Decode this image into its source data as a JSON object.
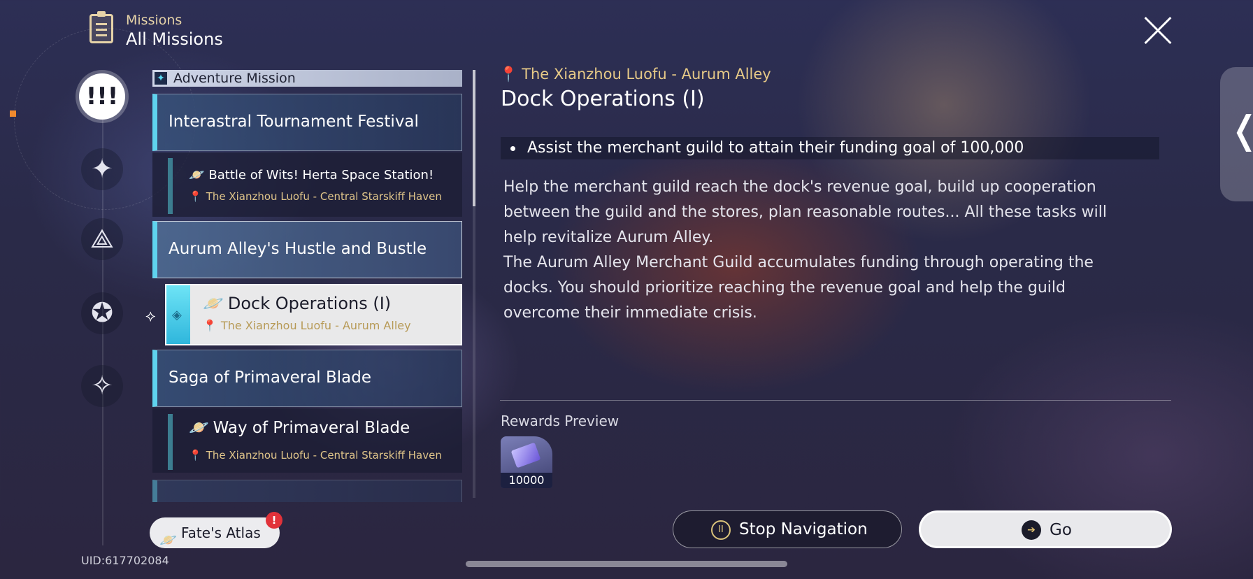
{
  "header": {
    "category": "Missions",
    "title": "All Missions",
    "icons": {
      "header": "clipboard-icon",
      "close": "close-icon"
    }
  },
  "rail": {
    "active_symbol": "!!!",
    "items": [
      {
        "name": "trailblaze-missions-icon",
        "symbol": "✦"
      },
      {
        "name": "companion-missions-icon",
        "symbol": "⟁"
      },
      {
        "name": "adventure-missions-icon",
        "symbol": "✪"
      },
      {
        "name": "daily-missions-icon",
        "symbol": "✧"
      }
    ],
    "marker_color": "#f08a2e"
  },
  "mission_list": {
    "category": "Adventure Mission",
    "category_icon": "✦",
    "groups": [
      {
        "title": "Interastral Tournament Festival",
        "missions": [
          {
            "title": "Battle of Wits! Herta Space Station!",
            "location": "The Xianzhou Luofu - Central Starskiff Haven"
          }
        ]
      },
      {
        "title": "Aurum Alley's Hustle and Bustle",
        "missions": [
          {
            "title": "Dock Operations (I)",
            "location": "The Xianzhou Luofu - Aurum Alley",
            "selected": true
          }
        ]
      },
      {
        "title": "Saga of Primaveral Blade",
        "missions": [
          {
            "title": "Way of Primaveral Blade",
            "location": "The Xianzhou Luofu - Central Starskiff Haven"
          }
        ]
      }
    ],
    "accent_color": "#5fd3ee",
    "location_color": "#e0c58a"
  },
  "detail": {
    "location": "The Xianzhou Luofu - Aurum Alley",
    "title": "Dock Operations (I)",
    "objective": "Assist the merchant guild to attain their funding goal of 100,000",
    "description_lines": [
      "Help the merchant guild reach the dock's revenue goal, build up cooperation",
      "between the guild and the stores, plan reasonable routes... All these tasks will",
      "help revitalize Aurum Alley.",
      "The Aurum Alley Merchant Guild accumulates funding through operating the",
      "docks. You should prioritize reaching the revenue goal and help the guild",
      "overcome their immediate crisis."
    ],
    "rewards_label": "Rewards Preview",
    "rewards": [
      {
        "icon": "credits-icon",
        "quantity": "10000"
      }
    ]
  },
  "buttons": {
    "stop_navigation": "Stop Navigation",
    "go": "Go",
    "fates_atlas": "Fate's Atlas",
    "fates_alert": "!"
  },
  "footer": {
    "uid": "UID:617702084"
  }
}
